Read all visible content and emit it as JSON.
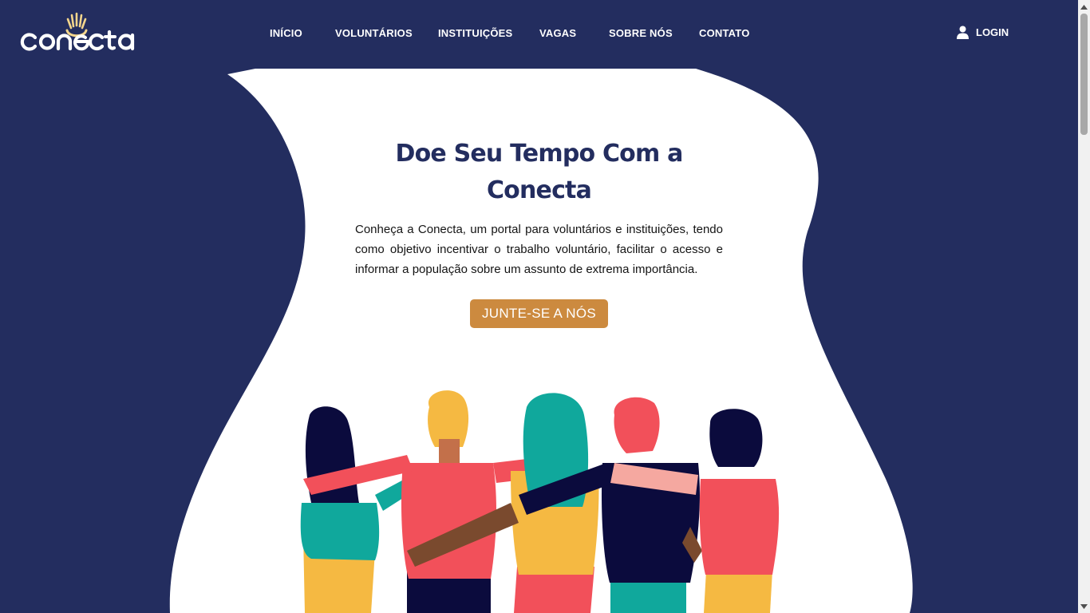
{
  "header": {
    "logo_text": "conecta",
    "nav": [
      {
        "label": "INÍCIO"
      },
      {
        "label": "VOLUNTÁRIOS"
      },
      {
        "label": "INSTITUIÇÕES"
      },
      {
        "label": "VAGAS"
      },
      {
        "label": "SOBRE NÓS"
      },
      {
        "label": "CONTATO"
      }
    ],
    "login_label": "LOGIN",
    "login_icon": "user-icon"
  },
  "hero": {
    "title": "Doe Seu Tempo Com a Conecta",
    "description": "Conheça a Conecta, um portal para voluntários e instituições, tendo como objetivo incentivar o trabalho voluntário, facilitar o acesso e informar a população sobre um assunto de extrema importância.",
    "cta_label": "JUNTE-SE A NÓS"
  },
  "colors": {
    "background": "#232d5f",
    "card": "#ffffff",
    "title": "#232d5f",
    "button": "#cc8a3f",
    "logo_accent": "#f3d58c"
  }
}
